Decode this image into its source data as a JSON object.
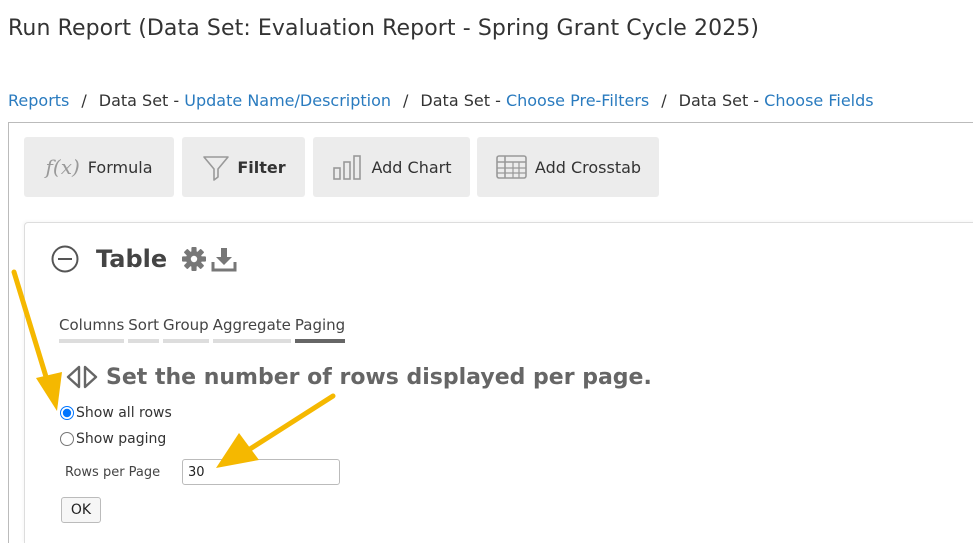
{
  "page": {
    "title": "Run Report (Data Set: Evaluation Report - Spring Grant Cycle 2025)"
  },
  "breadcrumb": {
    "separator": "/",
    "items": [
      {
        "prefix": "",
        "link": "Reports"
      },
      {
        "prefix": "Data Set - ",
        "link": "Update Name/Description"
      },
      {
        "prefix": "Data Set - ",
        "link": "Choose Pre-Filters"
      },
      {
        "prefix": "Data Set - ",
        "link": "Choose Fields"
      }
    ]
  },
  "toolbar": {
    "formula_label": "Formula",
    "formula_icon_text": "f(x)",
    "filter_label": "Filter",
    "chart_label": "Add Chart",
    "crosstab_label": "Add Crosstab"
  },
  "table": {
    "title": "Table",
    "tabs": [
      "Columns",
      "Sort",
      "Group",
      "Aggregate",
      "Paging"
    ],
    "active_tab": "Paging",
    "paging": {
      "heading": "Set the number of rows displayed per page.",
      "option_all": "Show all rows",
      "option_paging": "Show paging",
      "selected": "Show all rows",
      "rows_label": "Rows per Page",
      "rows_value": "30",
      "ok_label": "OK"
    }
  },
  "colors": {
    "link": "#2a7bbf",
    "annotation_arrow": "#f5b800",
    "button_bg": "#ececec"
  },
  "icons": [
    "formula-icon",
    "filter-icon",
    "chart-icon",
    "crosstab-icon",
    "collapse-icon",
    "gear-icon",
    "download-icon",
    "collapse-arrows-icon"
  ]
}
